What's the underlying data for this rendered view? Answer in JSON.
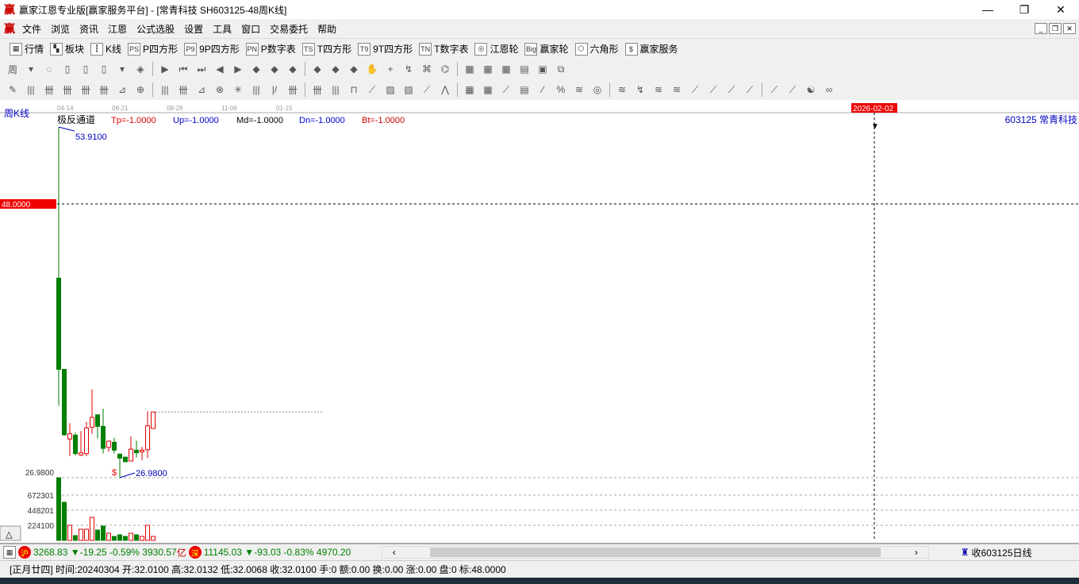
{
  "window": {
    "logo": "赢",
    "title": "赢家江恩专业版[赢家服务平台] - [常青科技  SH603125-48周K线]",
    "minimize": "—",
    "restore": "❐",
    "close": "✕"
  },
  "menu": [
    "文件",
    "浏览",
    "资讯",
    "江恩",
    "公式选股",
    "设置",
    "工具",
    "窗口",
    "交易委托",
    "帮助"
  ],
  "toolbar1": [
    {
      "icon": "▦",
      "label": "行情"
    },
    {
      "icon": "▚",
      "label": "板块"
    },
    {
      "icon": "┇",
      "label": "K线"
    },
    {
      "icon": "PS",
      "label": "P四方形"
    },
    {
      "icon": "P9",
      "label": "9P四方形"
    },
    {
      "icon": "PN",
      "label": "P数字表"
    },
    {
      "icon": "TS",
      "label": "T四方形"
    },
    {
      "icon": "T9",
      "label": "9T四方形"
    },
    {
      "icon": "TN",
      "label": "T数字表"
    },
    {
      "icon": "◎",
      "label": "江恩轮"
    },
    {
      "icon": "Big",
      "label": "赢家轮"
    },
    {
      "icon": "⬡",
      "label": "六角形"
    },
    {
      "icon": "$",
      "label": "赢家服务"
    }
  ],
  "toolbar2_icons": [
    "周",
    "▾",
    "◌",
    "▯",
    "▯",
    "▯",
    "▾",
    "◈",
    "▶",
    "⏮",
    "⏭",
    "◀",
    "▶",
    "◆",
    "◆",
    "◆",
    "◆",
    "◆",
    "◆",
    "✋",
    "+",
    "↯",
    "⌘",
    "⌬",
    "▦",
    "▦",
    "▦",
    "▤",
    "▣",
    "⧉"
  ],
  "toolbar3_icons": [
    "✎",
    "|||",
    "卌",
    "卌",
    "卌",
    "卌",
    "⊿",
    "⊕",
    "|||",
    "卌",
    "⊿",
    "⊗",
    "✳",
    "|||",
    "|/",
    "卌",
    "卌",
    "|||",
    "⊓",
    "⟋",
    "▨",
    "▨",
    "⟋",
    "⋀",
    "▦",
    "▦",
    "⟋",
    "▤",
    "⁄",
    "%",
    "≋",
    "◎",
    "≋",
    "↯",
    "≋",
    "≋",
    "⟋",
    "⟋",
    "⟋",
    "⟋",
    "⟋",
    "⟋",
    "☯",
    "∞"
  ],
  "chart": {
    "period_label": "周K线",
    "date_ticks": [
      "04-14",
      "06-21",
      "08-28",
      "11-06",
      "01-15"
    ],
    "indicator": {
      "name": "极反通道",
      "tp": "Tp=-1.0000",
      "up": "Up=-1.0000",
      "md": "Md=-1.0000",
      "dn": "Dn=-1.0000",
      "bt": "Bt=-1.0000"
    },
    "cursor_date": "2026-02-02",
    "stock": "603125  常青科技",
    "high_label": "53.9100",
    "low_label": "26.9800",
    "low_marker": "$",
    "cursor_price": "48.0000",
    "axis_low": "26.9800",
    "vol_ticks": [
      "672301",
      "448201",
      "224100"
    ],
    "colors": {
      "up": "#e00000",
      "down": "#007f00",
      "annot": "#0000c0"
    },
    "candles": [
      [
        42.3,
        53.91,
        32.5,
        35.3
      ],
      [
        35.3,
        35.3,
        30.2,
        30.27
      ],
      [
        29.95,
        31.16,
        28.63,
        30.35
      ],
      [
        30.25,
        30.45,
        28.69,
        28.83
      ],
      [
        28.73,
        30.56,
        28.63,
        28.89
      ],
      [
        28.83,
        31.27,
        28.63,
        30.8
      ],
      [
        30.86,
        33.76,
        30.35,
        31.61
      ],
      [
        31.81,
        31.81,
        29.99,
        30.92
      ],
      [
        30.92,
        32.28,
        28.83,
        29.23
      ],
      [
        29.3,
        29.84,
        28.97,
        29.78
      ],
      [
        29.7,
        30.05,
        28.83,
        29.09
      ],
      [
        28.79,
        28.79,
        26.98,
        28.48
      ],
      [
        28.56,
        28.56,
        28.2,
        28.2
      ],
      [
        28.26,
        30.15,
        28.26,
        29.17
      ],
      [
        29.09,
        29.84,
        28.52,
        28.89
      ],
      [
        28.97,
        29.34,
        28.32,
        29.09
      ],
      [
        29.13,
        32.08,
        28.48,
        30.96
      ],
      [
        30.76,
        32.02,
        30.76,
        32.02
      ]
    ],
    "volumes": [
      931000,
      566000,
      224000,
      71000,
      165000,
      165000,
      342000,
      153000,
      212000,
      106000,
      59000,
      83000,
      59000,
      106000,
      83000,
      59000,
      224000,
      59000
    ]
  },
  "indexbar": {
    "sh_badge": "沪",
    "sh": "3268.83 ▼-19.25 -0.59% 3930.57",
    "sh_unit": "亿",
    "sz_badge": "深",
    "sz": "11145.03 ▼-93.03 -0.83% 4970.20",
    "scroll_left": "‹",
    "scroll_right": "›",
    "receive": "收603125日线"
  },
  "status": "[正月廿四] 时间:20240304 开:32.0100 高:32.0132 低:32.0068 收:32.0100 手:0 额:0.00 换:0.00 涨:0.00 盘:0 标:48.0000",
  "expand_button": "△"
}
